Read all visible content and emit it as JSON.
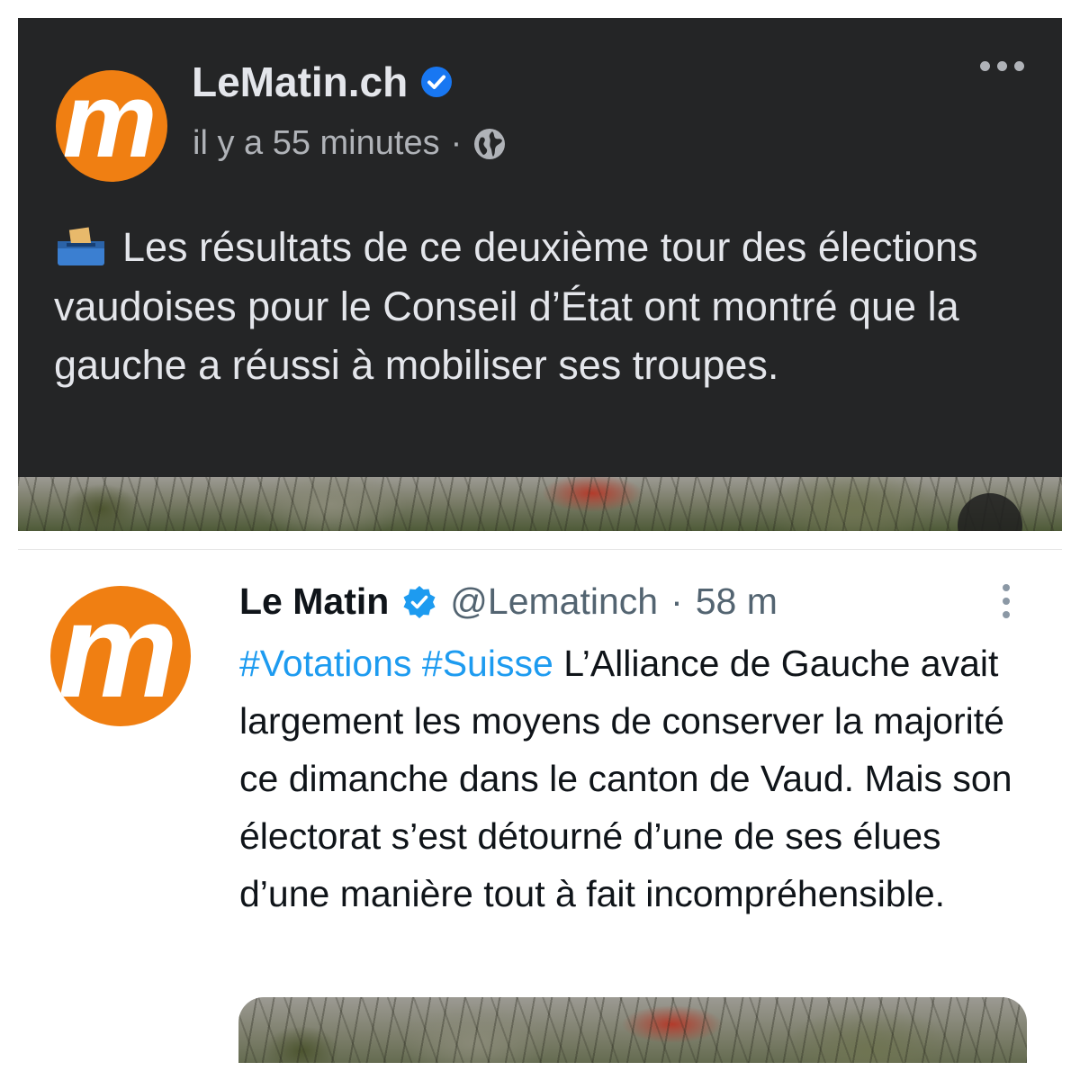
{
  "facebook_post": {
    "logo_letter": "m",
    "page_name": "LeMatin.ch",
    "timestamp": "il y a 55 minutes",
    "separator": "·",
    "text": "Les résultats de ce deuxième tour des élections vaudoises pour le Conseil d’État ont montré que la gauche a réussi à mobiliser ses troupes.",
    "emoji_icon": "ballot-box-icon",
    "colors": {
      "background": "#242526",
      "text": "#e4e6eb",
      "secondary": "#b0b3b8",
      "verified": "#1877f2"
    }
  },
  "tweet": {
    "logo_letter": "m",
    "display_name": "Le Matin",
    "handle": "@Lematinch",
    "separator": "·",
    "time": "58 m",
    "hashtag_1": "#Votations",
    "hashtag_2": "#Suisse",
    "text": "L’Alliance de Gauche avait largement les moyens de conserver la majorité ce dimanche dans le canton de Vaud. Mais son électorat s’est détourné d’une de ses élues d’une manière tout à fait incompréhensible.",
    "colors": {
      "hashtag": "#1d9bf0",
      "text": "#0f1419",
      "secondary": "#536471",
      "verified": "#1d9bf0"
    }
  },
  "brand_color": "#f07f12"
}
